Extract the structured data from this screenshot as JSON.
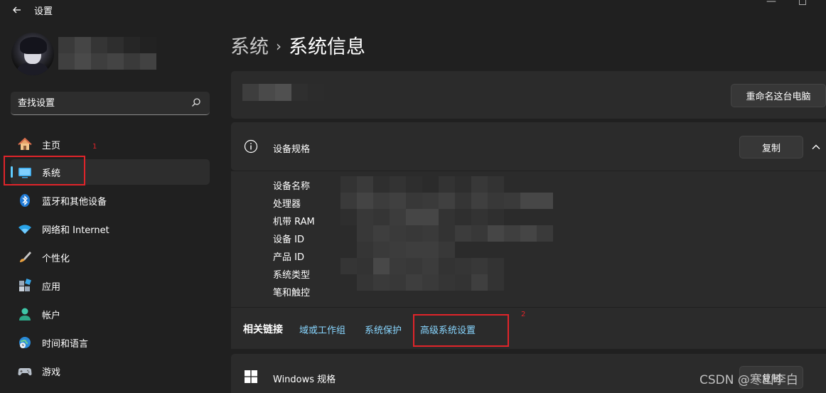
{
  "window": {
    "title": "设置",
    "back_icon": "back-arrow-icon"
  },
  "sidebar": {
    "search": {
      "placeholder": "查找设置"
    },
    "items": [
      {
        "label": "主页",
        "icon": "home-icon",
        "active": false
      },
      {
        "label": "系统",
        "icon": "system-display-icon",
        "active": true
      },
      {
        "label": "蓝牙和其他设备",
        "icon": "bluetooth-icon",
        "active": false
      },
      {
        "label": "网络和 Internet",
        "icon": "wifi-icon",
        "active": false
      },
      {
        "label": "个性化",
        "icon": "paintbrush-icon",
        "active": false
      },
      {
        "label": "应用",
        "icon": "apps-icon",
        "active": false
      },
      {
        "label": "帐户",
        "icon": "account-icon",
        "active": false
      },
      {
        "label": "时间和语言",
        "icon": "globe-clock-icon",
        "active": false
      },
      {
        "label": "游戏",
        "icon": "gamepad-icon",
        "active": false
      }
    ]
  },
  "annotations": {
    "marker_1": "1",
    "marker_2": "2"
  },
  "main": {
    "breadcrumb": {
      "parent": "系统",
      "separator": "›",
      "current": "系统信息"
    },
    "rename_button": "重命名这台电脑",
    "device_specs": {
      "title": "设备规格",
      "copy_button": "复制",
      "rows": [
        {
          "label": "设备名称"
        },
        {
          "label": "处理器"
        },
        {
          "label": "机带 RAM"
        },
        {
          "label": "设备 ID"
        },
        {
          "label": "产品 ID"
        },
        {
          "label": "系统类型"
        },
        {
          "label": "笔和触控"
        }
      ]
    },
    "related_links": {
      "label": "相关链接",
      "links": [
        "域或工作组",
        "系统保护",
        "高级系统设置"
      ]
    },
    "windows_specs": {
      "title": "Windows 规格",
      "copy_button": "复制"
    }
  },
  "watermark": "CSDN @寒山李白",
  "colors": {
    "background": "#202020",
    "card": "#2b2b2b",
    "accent": "#60cdff",
    "link": "#88d6ff",
    "annotation_red": "#e0242a"
  }
}
